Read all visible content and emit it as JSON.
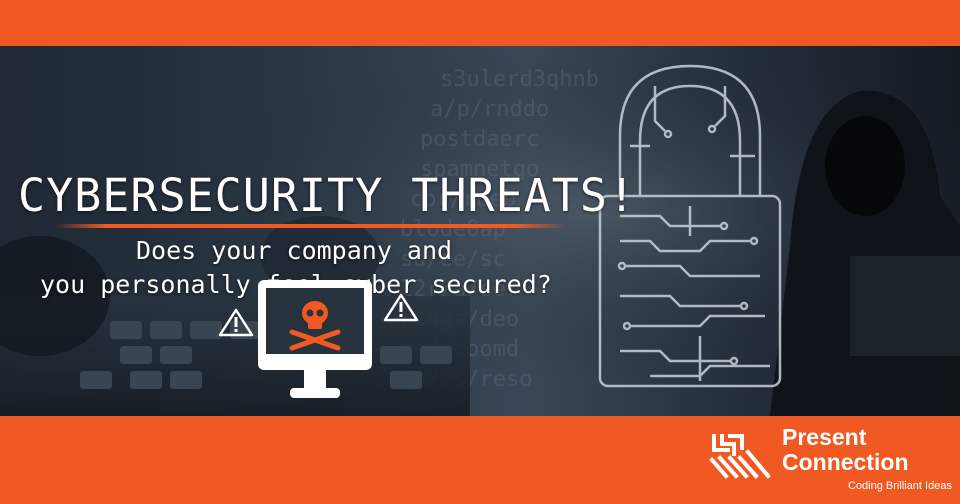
{
  "banner": {
    "headline": "CYBERSECURITY THREATS!",
    "subline1": "Does your company and",
    "subline2": "you personally feel cyber secured?"
  },
  "logo": {
    "name_line1": "Present",
    "name_line2": "Connection",
    "tagline": "Coding Brilliant Ideas"
  },
  "colors": {
    "accent": "#f05a22",
    "text": "#ffffff",
    "photo_dark": "#1f2833"
  },
  "icons": [
    "skull-crossbones-icon",
    "warning-triangle-icon",
    "monitor-icon",
    "padlock-circuit-icon",
    "logo-stripes-icon"
  ]
}
